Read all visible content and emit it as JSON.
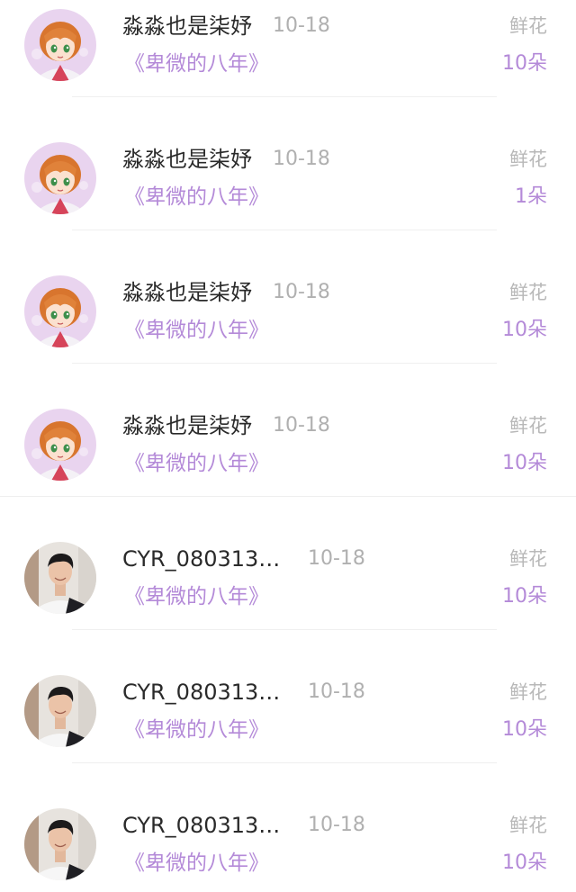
{
  "colors": {
    "accent": "#b48ad8",
    "name_text": "#2a2a2a",
    "muted": "#b0b0b0"
  },
  "rows": [
    {
      "name": "淼淼也是柒妤",
      "date": "10-18",
      "book": "《卑微的八年》",
      "gift": "鲜花",
      "count": "10朵",
      "avatar": "anime-girl-avatar"
    },
    {
      "name": "淼淼也是柒妤",
      "date": "10-18",
      "book": "《卑微的八年》",
      "gift": "鲜花",
      "count": "1朵",
      "avatar": "anime-girl-avatar"
    },
    {
      "name": "淼淼也是柒妤",
      "date": "10-18",
      "book": "《卑微的八年》",
      "gift": "鲜花",
      "count": "10朵",
      "avatar": "anime-girl-avatar"
    },
    {
      "name": "淼淼也是柒妤",
      "date": "10-18",
      "book": "《卑微的八年》",
      "gift": "鲜花",
      "count": "10朵",
      "avatar": "anime-girl-avatar"
    },
    {
      "name": "CYR_080313…",
      "date": "10-18",
      "book": "《卑微的八年》",
      "gift": "鲜花",
      "count": "10朵",
      "avatar": "man-photo-avatar"
    },
    {
      "name": "CYR_080313…",
      "date": "10-18",
      "book": "《卑微的八年》",
      "gift": "鲜花",
      "count": "10朵",
      "avatar": "man-photo-avatar"
    },
    {
      "name": "CYR_080313…",
      "date": "10-18",
      "book": "《卑微的八年》",
      "gift": "鲜花",
      "count": "10朵",
      "avatar": "man-photo-avatar"
    }
  ]
}
